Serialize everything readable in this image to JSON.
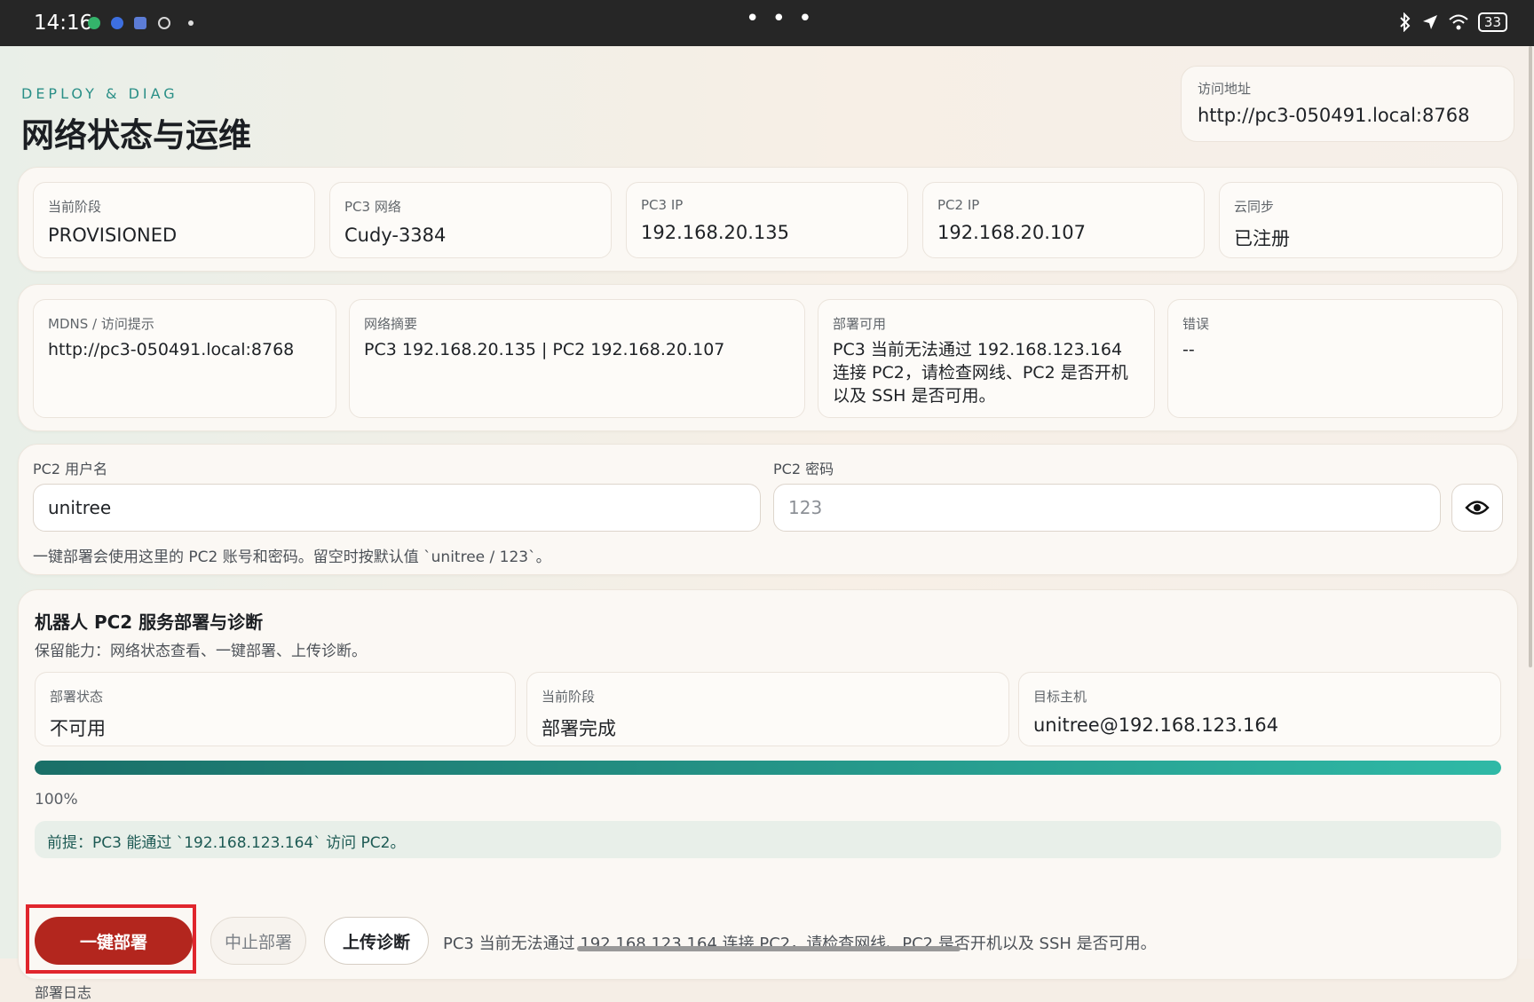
{
  "status_bar": {
    "time": "14:16",
    "more": "• • •",
    "battery": "33"
  },
  "header": {
    "eyebrow": "DEPLOY & DIAG",
    "title": "网络状态与运维",
    "access": {
      "label": "访问地址",
      "value": "http://pc3-050491.local:8768"
    }
  },
  "summary": {
    "tiles": [
      {
        "label": "当前阶段",
        "value": "PROVISIONED"
      },
      {
        "label": "PC3 网络",
        "value": "Cudy-3384"
      },
      {
        "label": "PC3 IP",
        "value": "192.168.20.135"
      },
      {
        "label": "PC2 IP",
        "value": "192.168.20.107"
      },
      {
        "label": "云同步",
        "value": "已注册"
      }
    ]
  },
  "details": {
    "tiles": [
      {
        "label": "MDNS / 访问提示",
        "value": "http://pc3-050491.local:8768"
      },
      {
        "label": "网络摘要",
        "value": "PC3 192.168.20.135 | PC2 192.168.20.107"
      },
      {
        "label": "部署可用",
        "value": "PC3 当前无法通过 192.168.123.164 连接 PC2，请检查网线、PC2 是否开机以及 SSH 是否可用。"
      },
      {
        "label": "错误",
        "value": "--"
      }
    ]
  },
  "credentials": {
    "username_label": "PC2 用户名",
    "username_value": "unitree",
    "password_label": "PC2 密码",
    "password_placeholder": "123",
    "hint": "一键部署会使用这里的 PC2 账号和密码。留空时按默认值 `unitree / 123`。"
  },
  "deploy": {
    "title": "机器人 PC2 服务部署与诊断",
    "subtitle": "保留能力：网络状态查看、一键部署、上传诊断。",
    "tiles": [
      {
        "label": "部署状态",
        "value": "不可用"
      },
      {
        "label": "当前阶段",
        "value": "部署完成"
      },
      {
        "label": "目标主机",
        "value": "unitree@192.168.123.164"
      }
    ],
    "progress_percent": 100,
    "progress_label": "100%",
    "note": "前提：PC3 能通过 `192.168.123.164` 访问 PC2。",
    "buttons": {
      "deploy": "一键部署",
      "stop": "中止部署",
      "upload": "上传诊断"
    },
    "message": "PC3 当前无法通过 192.168.123.164 连接 PC2，请检查网线、PC2 是否开机以及 SSH 是否可用。",
    "log_label": "部署日志"
  },
  "colors": {
    "accent": "#2a8f87",
    "primary_button": "#b3261e",
    "highlight": "#e0262d"
  }
}
